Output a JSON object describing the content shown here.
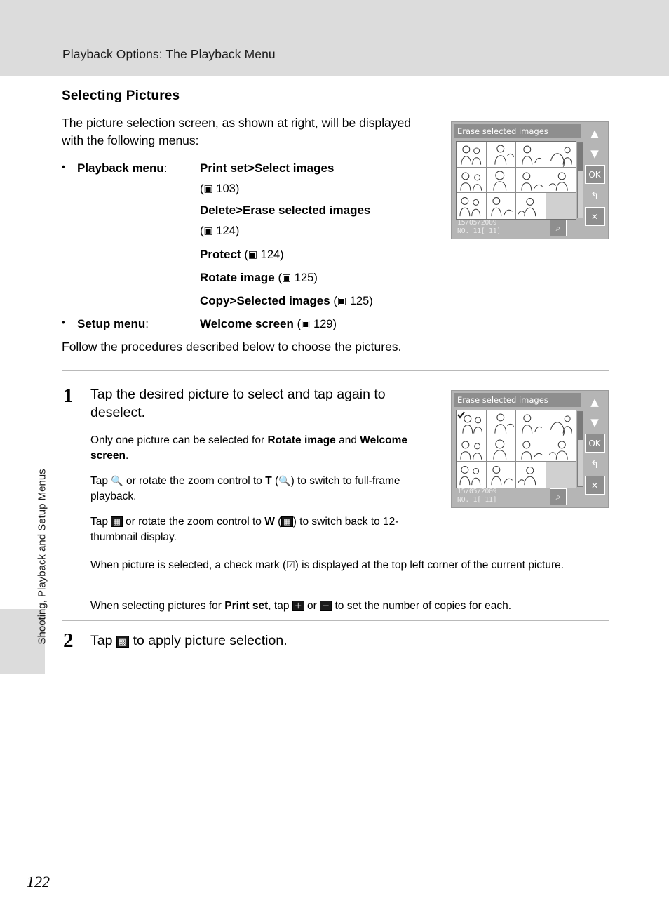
{
  "header": {
    "title": "Playback Options: The Playback Menu"
  },
  "side_tab": {
    "label": "Shooting, Playback and Setup Menus"
  },
  "page": {
    "number": "122"
  },
  "section": {
    "title": "Selecting Pictures",
    "intro": "The picture selection screen, as shown at right, will be displayed with the following menus:",
    "follow_text": "Follow the procedures described below to choose the pictures."
  },
  "bullets": [
    {
      "label": "Playback menu",
      "colon": ":",
      "entries": [
        {
          "bold": "Print set",
          "sep": ">",
          "bold2": "Select images",
          "ref": "(",
          "ref_page": "103",
          "ref_close": ")"
        },
        {
          "bold": "Delete",
          "sep": ">",
          "bold2": "Erase selected images",
          "ref": "(",
          "ref_page": "124",
          "ref_close": ")"
        },
        {
          "bold": "Protect",
          "sep": "",
          "bold2": "",
          "ref": "(",
          "ref_page": "124",
          "ref_close": ")"
        },
        {
          "bold": "Rotate image",
          "sep": "",
          "bold2": "",
          "ref": "(",
          "ref_page": "125",
          "ref_close": ")"
        },
        {
          "bold": "Copy",
          "sep": ">",
          "bold2": "Selected images",
          "ref": "(",
          "ref_page": "125",
          "ref_close": ")"
        }
      ]
    },
    {
      "label": "Setup menu",
      "colon": ":",
      "entries": [
        {
          "bold": "Welcome screen",
          "sep": "",
          "bold2": "",
          "ref": "(",
          "ref_page": "129",
          "ref_close": ")"
        }
      ]
    }
  ],
  "steps": [
    {
      "num": "1",
      "head": "Tap the desired picture to select and tap again to deselect.",
      "paras": [
        {
          "pre": "Only one picture can be selected for ",
          "b1": "Rotate image",
          "mid": " and ",
          "b2": "Welcome screen",
          "post": "."
        },
        {
          "pre": "Tap ",
          "icon1": "magnify",
          "mid1": " or rotate the zoom control to ",
          "b1": "T",
          "mid2": " (",
          "icon2": "tele",
          "mid3": ") to switch to full-frame playback."
        },
        {
          "pre": "Tap ",
          "icon1": "thumbs",
          "mid1": " or rotate the zoom control to ",
          "b1": "W",
          "mid2": " (",
          "icon2": "wide",
          "mid3": ") to switch back to 12-thumbnail display."
        },
        {
          "pre": "When picture is selected, a check mark (",
          "icon1": "check",
          "post": ") is displayed at the top left corner of the current picture."
        },
        {
          "pre": "When selecting pictures for ",
          "b1": "Print set",
          "mid1": ", tap ",
          "icon1": "plus",
          "mid2": " or ",
          "icon2": "minus",
          "post": " to set the number of copies for each."
        }
      ]
    },
    {
      "num": "2",
      "head_pre": "Tap ",
      "head_icon": "apply",
      "head_post": " to apply picture selection."
    }
  ],
  "camera_screens": [
    {
      "id": "top",
      "title": "Erase selected images",
      "date": "15/05/2009",
      "counter_label": "NO.",
      "counter_value": "11[    11]"
    },
    {
      "id": "step1",
      "title": "Erase selected images",
      "date": "15/05/2009",
      "counter_label": "NO.",
      "counter_value": "1[    11]"
    }
  ],
  "camera_buttons": {
    "up": "▲",
    "down": "▼",
    "ok": "OK",
    "back": "↰",
    "close": "✕",
    "magnify": "⌕"
  },
  "colors": {
    "band": "#dcdcdc",
    "screen_bg": "#b5b5b5",
    "rule": "#b9b9b9"
  }
}
